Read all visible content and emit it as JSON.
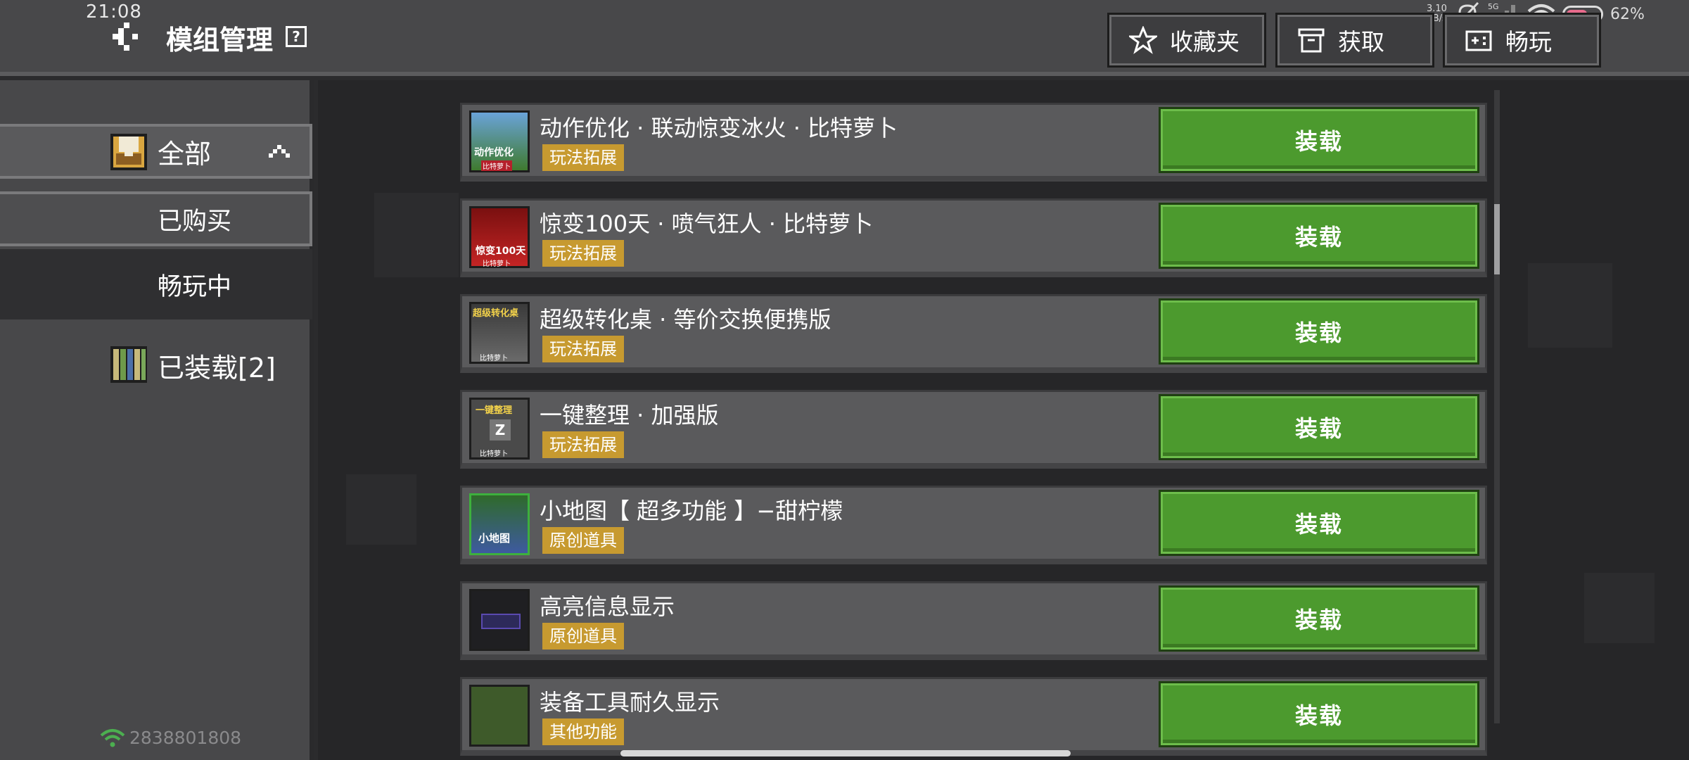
{
  "status": {
    "time": "21:08",
    "net_speed_value": "3.10",
    "net_speed_unit": "KB/s",
    "network": "5G",
    "battery": "62%",
    "battery_level": 0.62
  },
  "header": {
    "title": "模组管理",
    "help": "?",
    "buttons": {
      "favorites": "收藏夹",
      "get": "获取",
      "play": "畅玩"
    }
  },
  "sidebar": {
    "all": "全部",
    "bought": "已购买",
    "playing": "畅玩中",
    "loaded": "已装载[2]",
    "account": "2838801808"
  },
  "mods": [
    {
      "title": "动作优化 · 联动惊变冰火 · 比特萝卜",
      "tag": "玩法拓展",
      "button": "装载",
      "thumb_text": "动作优化",
      "thumb_sub": "比特萝卜"
    },
    {
      "title": "惊变100天 · 喷气狂人 · 比特萝卜",
      "tag": "玩法拓展",
      "button": "装载",
      "thumb_text": "惊变100天",
      "thumb_sub": "比特萝卜"
    },
    {
      "title": "超级转化桌 · 等价交换便携版",
      "tag": "玩法拓展",
      "button": "装载",
      "thumb_text": "超级转化桌",
      "thumb_sub": "比特萝卜"
    },
    {
      "title": "一键整理 · 加强版",
      "tag": "玩法拓展",
      "button": "装载",
      "thumb_text": "一键整理",
      "thumb_sub": "比特萝卜"
    },
    {
      "title": "小地图【 超多功能 】−甜柠檬",
      "tag": "原创道具",
      "button": "装载",
      "thumb_text": "小地图",
      "thumb_sub": ""
    },
    {
      "title": "高亮信息显示",
      "tag": "原创道具",
      "button": "装载",
      "thumb_text": "",
      "thumb_sub": ""
    },
    {
      "title": "装备工具耐久显示",
      "tag": "其他功能",
      "button": "装载",
      "thumb_text": "",
      "thumb_sub": ""
    }
  ],
  "colors": {
    "accent_green": "#4c9a2e",
    "tag_gold": "#c79a30",
    "panel": "#48484a"
  }
}
